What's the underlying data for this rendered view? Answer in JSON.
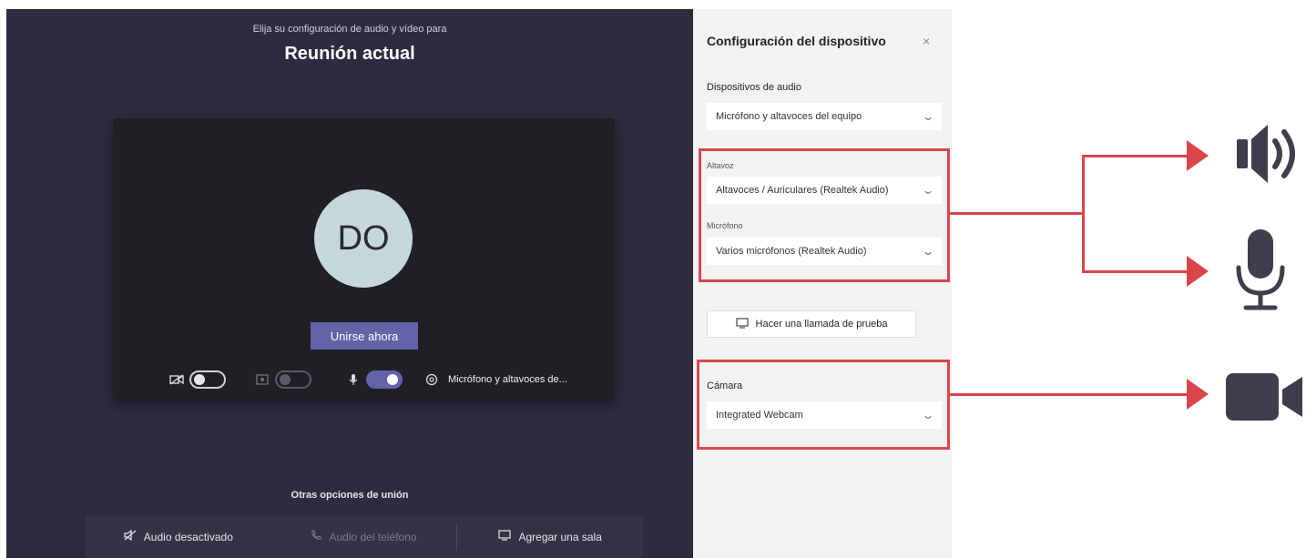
{
  "teams": {
    "subtitle": "Elija su configuración de audio y vídeo para",
    "title": "Reunión actual",
    "avatar_initials": "DO",
    "join_button": "Unirse ahora",
    "device_label": "Micrófono y altavoces de...",
    "other_options_title": "Otras opciones de unión",
    "options": [
      {
        "label": "Audio desactivado",
        "icon": "audio-off-icon"
      },
      {
        "label": "Audio del teléfono",
        "icon": "phone-icon"
      },
      {
        "label": "Agregar una sala",
        "icon": "room-icon"
      }
    ],
    "accent_color": "#6264a7"
  },
  "panel": {
    "title": "Configuración del dispositivo",
    "close": "×",
    "audio_devices_label": "Dispositivos de audio",
    "audio_devices_value": "Micrófono y altavoces del equipo",
    "speakers_label": "Altavoz",
    "speakers_value": "Altavoces / Auriculares (Realtek Audio)",
    "microphone_label": "Micrófono",
    "microphone_value": "Varios micrófonos (Realtek Audio)",
    "test_call_button": "Hacer una llamada de prueba",
    "camera_label": "Cámara",
    "camera_value": "Integrated Webcam"
  },
  "annotation": {
    "highlight_color": "#d9464a",
    "icons": [
      "speaker-icon",
      "microphone-icon",
      "video-camera-icon"
    ]
  }
}
